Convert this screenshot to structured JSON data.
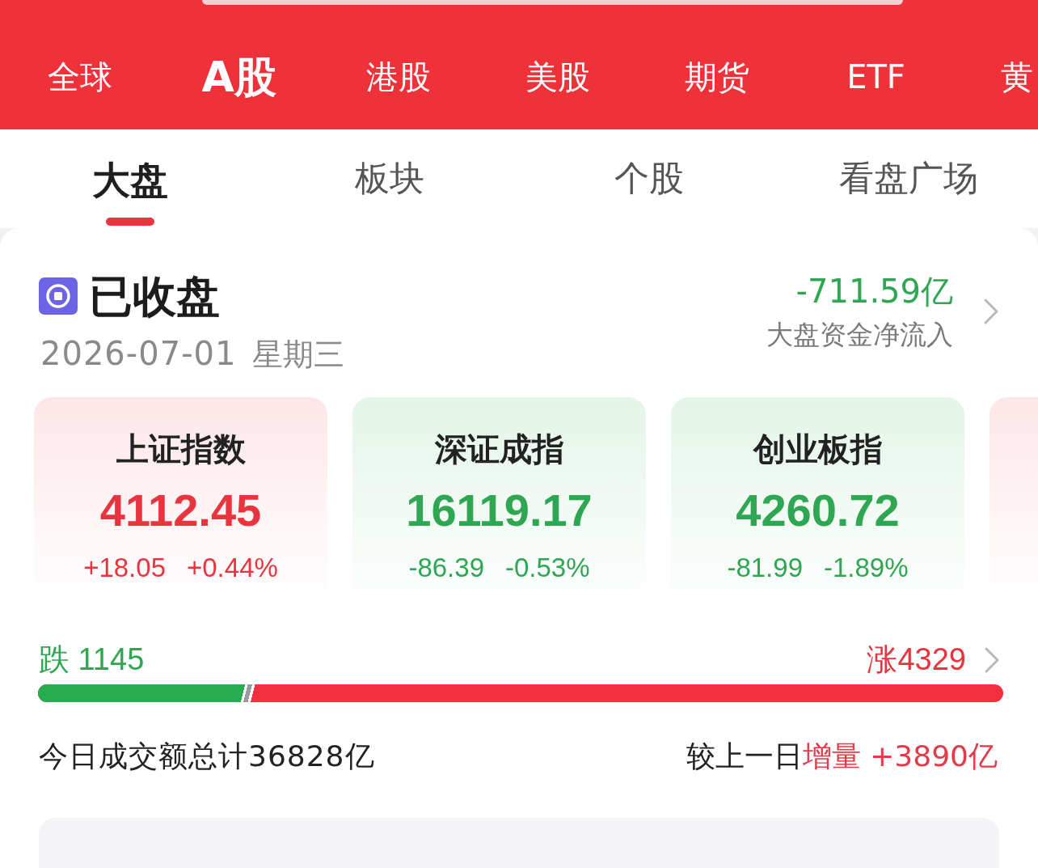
{
  "top_bar": {
    "market_tabs": [
      {
        "label": "全球",
        "selected": false
      },
      {
        "label": "A股",
        "selected": true
      },
      {
        "label": "港股",
        "selected": false
      },
      {
        "label": "美股",
        "selected": false
      },
      {
        "label": "期货",
        "selected": false
      },
      {
        "label": "ETF",
        "selected": false
      },
      {
        "label": "黄",
        "selected": false
      }
    ]
  },
  "view_tabs": [
    {
      "label": "大盘",
      "selected": true
    },
    {
      "label": "板块",
      "selected": false
    },
    {
      "label": "个股",
      "selected": false
    },
    {
      "label": "看盘广场",
      "selected": false
    }
  ],
  "market_status": {
    "label": "已收盘",
    "date": "2026-07-01",
    "weekday": "星期三"
  },
  "fund_flow": {
    "value": "-711.59亿",
    "label": "大盘资金净流入",
    "rising": false
  },
  "indices": [
    {
      "name": "上证指数",
      "value": "4112.45",
      "change": "+18.05",
      "percent": "+0.44%",
      "rising": true
    },
    {
      "name": "深证成指",
      "value": "16119.17",
      "change": "-86.39",
      "percent": "-0.53%",
      "rising": false
    },
    {
      "name": "创业板指",
      "value": "4260.72",
      "change": "-81.99",
      "percent": "-1.89%",
      "rising": false
    },
    {
      "rising": true
    }
  ],
  "breadth": {
    "falling": "跌 1145",
    "rising": "涨4329",
    "level": 0.21
  },
  "turnover": {
    "total": "今日成交额总计36828亿",
    "compare_label": "较上一日",
    "change": "增量 +3890亿"
  }
}
